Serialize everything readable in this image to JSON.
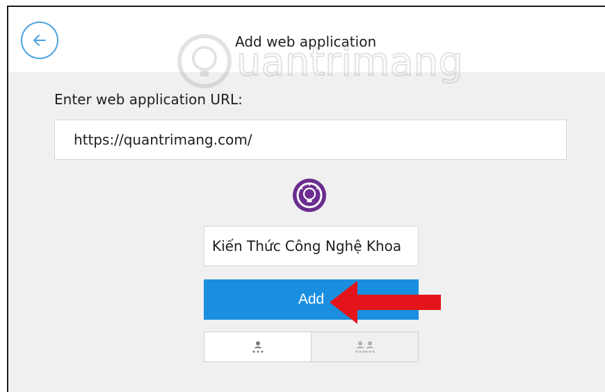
{
  "header": {
    "title": "Add web application",
    "back_icon": "arrow-left-icon"
  },
  "watermark": {
    "text": "Quantrimang"
  },
  "form": {
    "url_label": "Enter web application URL:",
    "url_value": "https://quantrimang.com/",
    "app_icon": "lightbulb-icon",
    "name_value": "Kiến Thức Công Nghệ Khoa",
    "add_label": "Add"
  },
  "mode_toggle": {
    "options": [
      {
        "icon": "single-user-icon",
        "selected": true
      },
      {
        "icon": "multi-user-icon",
        "selected": false
      }
    ]
  },
  "colors": {
    "accent": "#1a8fe0",
    "back_ring": "#4aa3e0",
    "app_icon": "#6b2d8f",
    "arrow": "#e3151a"
  }
}
